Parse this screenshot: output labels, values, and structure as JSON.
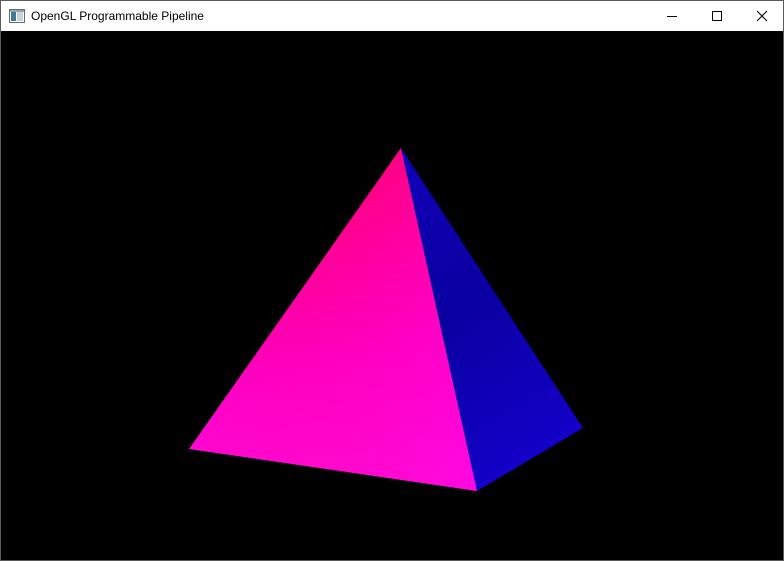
{
  "window": {
    "title": "OpenGL Programmable Pipeline",
    "controls": {
      "minimize_icon": "minimize-icon",
      "maximize_icon": "maximize-icon",
      "close_icon": "close-icon"
    }
  },
  "scene": {
    "background_color": "#000000",
    "pyramid": {
      "front_face_colors": [
        "#ff0070",
        "#ff00c8",
        "#ff10e6"
      ],
      "side_face_colors": [
        "#1000b8",
        "#0a00a0",
        "#1400c8"
      ]
    }
  }
}
